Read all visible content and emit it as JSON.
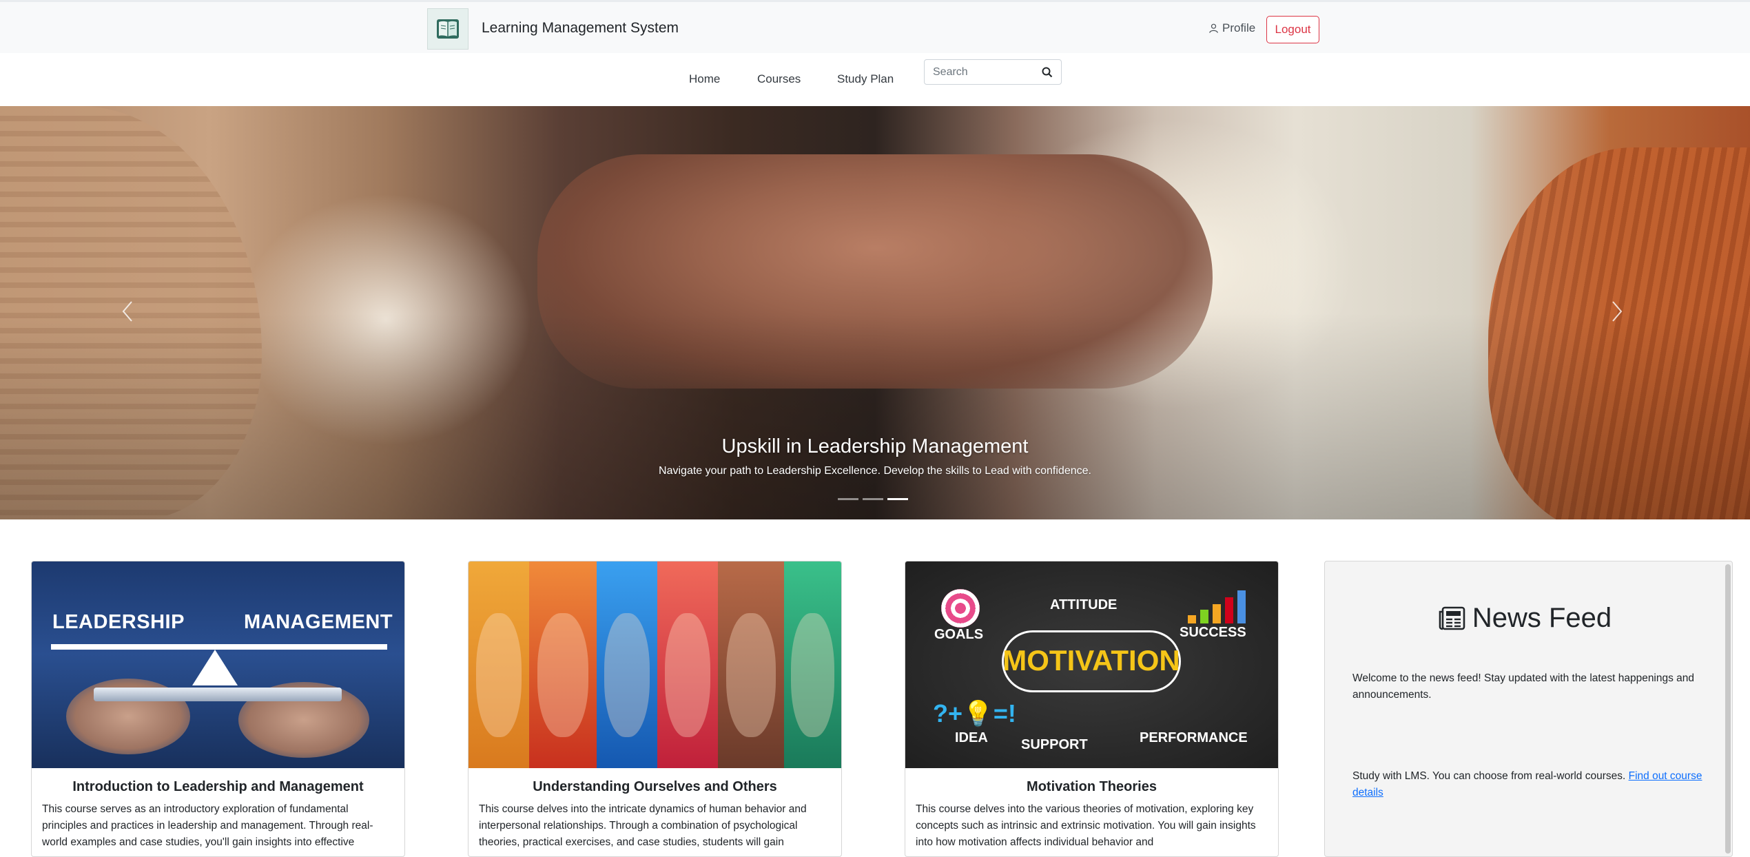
{
  "header": {
    "app_title": "Learning Management System",
    "logo_icon": "book-logo-icon",
    "profile_label": "Profile",
    "logout_label": "Logout",
    "logout_color": "#dc3545"
  },
  "nav": {
    "items": [
      {
        "label": "Home"
      },
      {
        "label": "Courses"
      },
      {
        "label": "Study Plan"
      }
    ],
    "search": {
      "placeholder": "Search",
      "value": ""
    }
  },
  "hero": {
    "title": "Upskill in Leadership Management",
    "subtitle": "Navigate your path to Leadership Excellence. Develop the skills to Lead with confidence.",
    "slide_count": 3,
    "active_slide": 3
  },
  "courses": [
    {
      "title": "Introduction to Leadership and Management",
      "description": "This course serves as an introductory exploration of fundamental principles and practices in leadership and management. Through real-world examples and case studies, you'll gain insights into effective",
      "image_words": [
        "LEADERSHIP",
        "MANAGEMENT"
      ]
    },
    {
      "title": "Understanding Ourselves and Others",
      "description": "This course delves into the intricate dynamics of human behavior and interpersonal relationships. Through a combination of psychological theories, practical exercises, and case studies, students will gain",
      "image_colors": [
        "#e8902a",
        "#d9402a",
        "#1f7fd6",
        "#d83a4a",
        "#9b4a2e",
        "#2a9a6a"
      ]
    },
    {
      "title": "Motivation Theories",
      "description": "This course delves into the various theories of motivation, exploring key concepts such as intrinsic and extrinsic motivation. You will gain insights into how motivation affects individual behavior and",
      "image_words": [
        "MOTIVATION",
        "GOALS",
        "ATTITUDE",
        "SUCCESS",
        "IDEA",
        "SUPPORT",
        "PERFORMANCE"
      ]
    }
  ],
  "news_feed": {
    "title": "News Feed",
    "icon": "newspaper-icon",
    "welcome": "Welcome to the news feed! Stay updated with the latest happenings and announcements.",
    "study_text": "Study with LMS. You can choose from real-world courses. ",
    "link_label": "Find out course details",
    "link_color": "#0d6efd"
  }
}
